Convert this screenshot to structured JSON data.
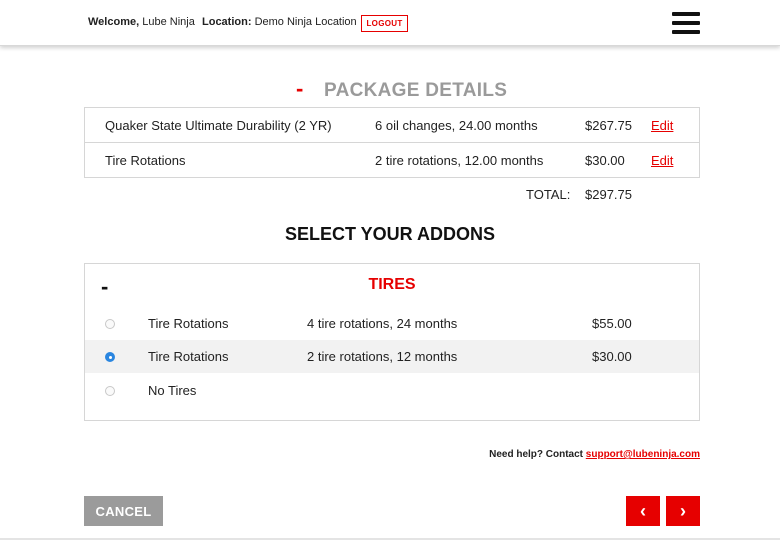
{
  "header": {
    "welcome_label": "Welcome,",
    "welcome_name": "Lube Ninja",
    "location_label": "Location:",
    "location_name": "Demo Ninja Location",
    "logout_label": "LOGOUT",
    "menu_icon": "hamburger-menu-icon"
  },
  "package": {
    "toggle": "-",
    "title": "PACKAGE DETAILS",
    "rows": [
      {
        "name": "Quaker State Ultimate Durability (2 YR)",
        "desc": "6 oil changes, 24.00 months",
        "price": "$267.75",
        "edit": "Edit"
      },
      {
        "name": "Tire Rotations",
        "desc": "2 tire rotations, 12.00 months",
        "price": "$30.00",
        "edit": "Edit"
      }
    ],
    "total_label": "TOTAL:",
    "total_value": "$297.75"
  },
  "addons": {
    "title": "SELECT YOUR ADDONS",
    "toggle": "-",
    "category": "TIRES",
    "options": [
      {
        "name": "Tire Rotations",
        "desc": "4 tire rotations, 24 months",
        "price": "$55.00",
        "selected": false
      },
      {
        "name": "Tire Rotations",
        "desc": "2 tire rotations, 12 months",
        "price": "$30.00",
        "selected": true
      },
      {
        "name": "No Tires",
        "desc": "",
        "price": "",
        "selected": false
      }
    ]
  },
  "help": {
    "text": "Need help? Contact",
    "email": "support@lubeninja.com"
  },
  "footer": {
    "cancel_label": "CANCEL",
    "prev_label": "‹",
    "next_label": "›"
  },
  "colors": {
    "accent": "#e60000",
    "muted": "#9b9b9b",
    "radio_selected": "#2a86e0"
  }
}
